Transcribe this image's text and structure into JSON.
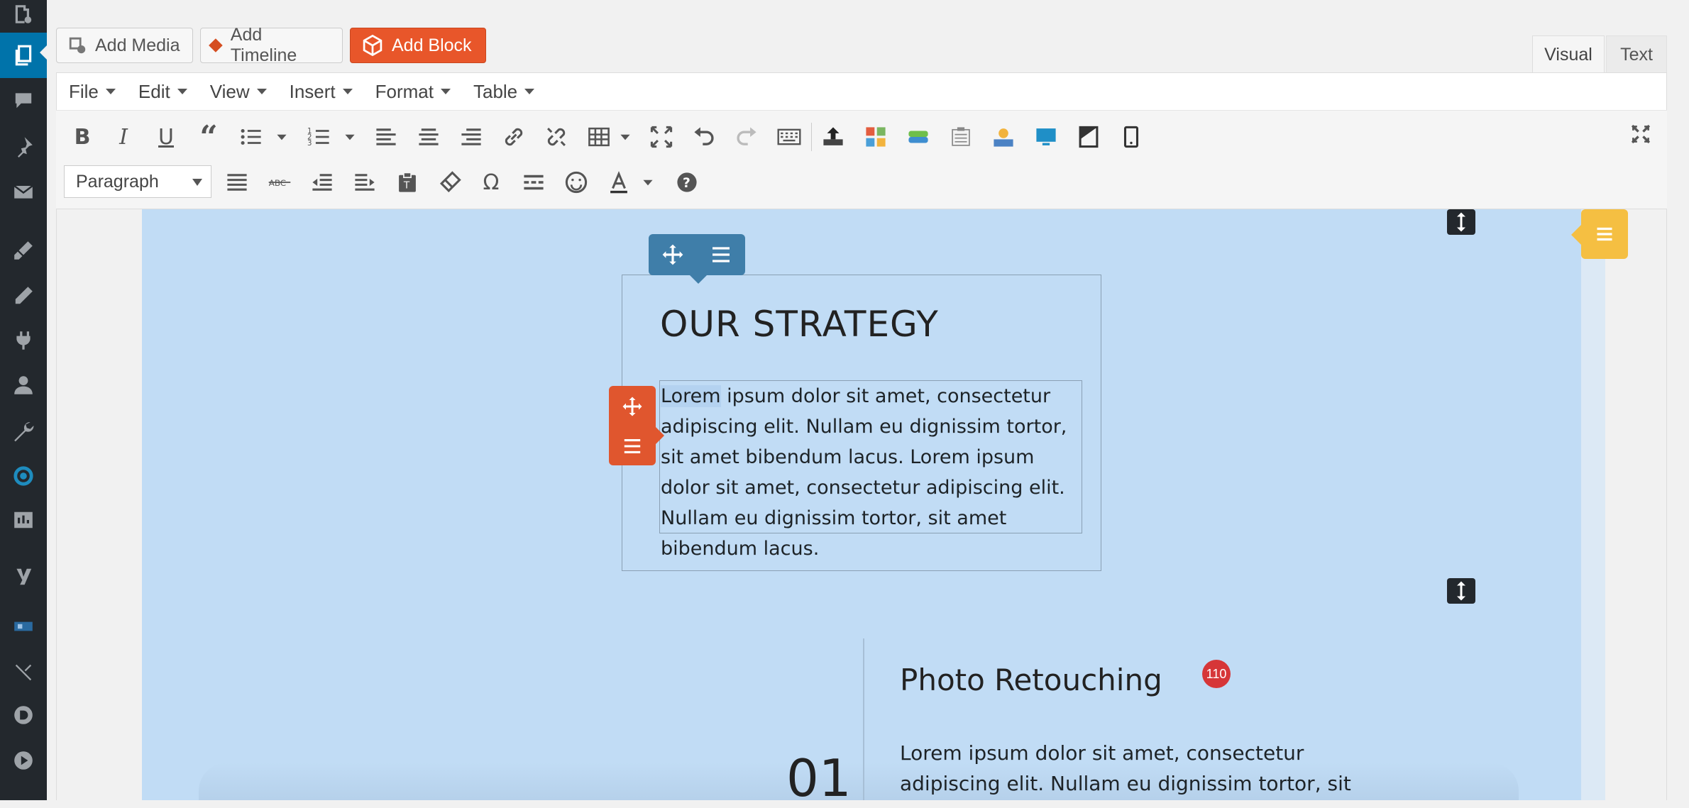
{
  "media_buttons": {
    "add_media": "Add Media",
    "add_timeline": "Add Timeline",
    "add_block": "Add Block"
  },
  "editor_tabs": {
    "visual": "Visual",
    "text": "Text"
  },
  "menubar": [
    "File",
    "Edit",
    "View",
    "Insert",
    "Format",
    "Table"
  ],
  "toolbar": {
    "format_select": "Paragraph"
  },
  "content": {
    "section1": {
      "heading": "OUR STRATEGY",
      "paragraph_selected": "Lorem",
      "paragraph_rest": " ipsum dolor sit amet, consectetur adipiscing elit. Nullam eu dignissim tortor, sit amet bibendum lacus. Lorem ipsum dolor sit amet, consectetur adipiscing elit. Nullam eu dignissim tortor, sit amet bibendum lacus."
    },
    "section2": {
      "number": "01",
      "heading": "Photo Retouching",
      "badge": "110",
      "paragraph": "Lorem ipsum dolor sit amet, consectetur adipiscing elit. Nullam eu dignissim tortor, sit"
    }
  },
  "colors": {
    "section_bg": "#c1dcf5",
    "add_block_button": "#e8562a",
    "block_toolbar": "#3f7ea9",
    "element_toolbar": "#e0562e",
    "row_toolbar": "#f5bf42",
    "admin_sidebar": "#23282d",
    "active_menu": "#0073aa"
  }
}
